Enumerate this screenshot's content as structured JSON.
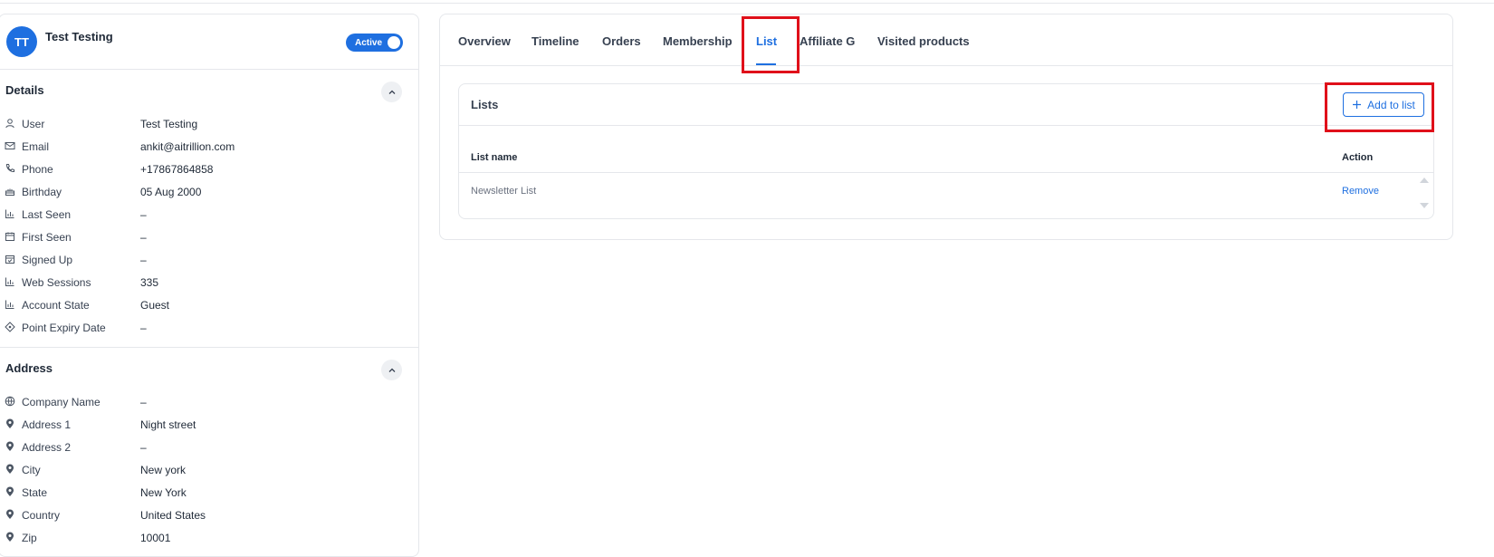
{
  "profile": {
    "initials": "TT",
    "name": "Test Testing",
    "status": "Active"
  },
  "details": {
    "title": "Details",
    "rows": [
      {
        "icon": "user-icon",
        "label": "User",
        "value": "Test Testing"
      },
      {
        "icon": "email-icon",
        "label": "Email",
        "value": "ankit@aitrillion.com"
      },
      {
        "icon": "phone-icon",
        "label": "Phone",
        "value": "+17867864858"
      },
      {
        "icon": "cake-icon",
        "label": "Birthday",
        "value": "05 Aug 2000"
      },
      {
        "icon": "chart-icon",
        "label": "Last Seen",
        "value": "–"
      },
      {
        "icon": "calendar-icon",
        "label": "First Seen",
        "value": "–"
      },
      {
        "icon": "calendar-check-icon",
        "label": "Signed Up",
        "value": "–"
      },
      {
        "icon": "chart-icon",
        "label": "Web Sessions",
        "value": "335"
      },
      {
        "icon": "chart-icon",
        "label": "Account State",
        "value": "Guest"
      },
      {
        "icon": "diamond-icon",
        "label": "Point Expiry Date",
        "value": "–"
      }
    ]
  },
  "address": {
    "title": "Address",
    "rows": [
      {
        "icon": "globe-icon",
        "label": "Company Name",
        "value": "–"
      },
      {
        "icon": "location-icon",
        "label": "Address 1",
        "value": "Night street"
      },
      {
        "icon": "location-icon",
        "label": "Address 2",
        "value": "–"
      },
      {
        "icon": "location-icon",
        "label": "City",
        "value": "New york"
      },
      {
        "icon": "location-icon",
        "label": "State",
        "value": "New York"
      },
      {
        "icon": "location-icon",
        "label": "Country",
        "value": "United States"
      },
      {
        "icon": "location-icon",
        "label": "Zip",
        "value": "10001"
      }
    ]
  },
  "tabs": [
    {
      "label": "Overview"
    },
    {
      "label": "Timeline"
    },
    {
      "label": "Orders"
    },
    {
      "label": "Membership"
    },
    {
      "label": "List"
    },
    {
      "label": "Affiliate G"
    },
    {
      "label": "Visited products"
    }
  ],
  "active_tab": "List",
  "lists": {
    "title": "Lists",
    "add_label": "Add to list",
    "columns": {
      "name": "List name",
      "action": "Action"
    },
    "rows": [
      {
        "name": "Newsletter List",
        "action": "Remove"
      }
    ]
  },
  "colors": {
    "accent": "#1e6fe0",
    "highlight": "#e0101a"
  }
}
